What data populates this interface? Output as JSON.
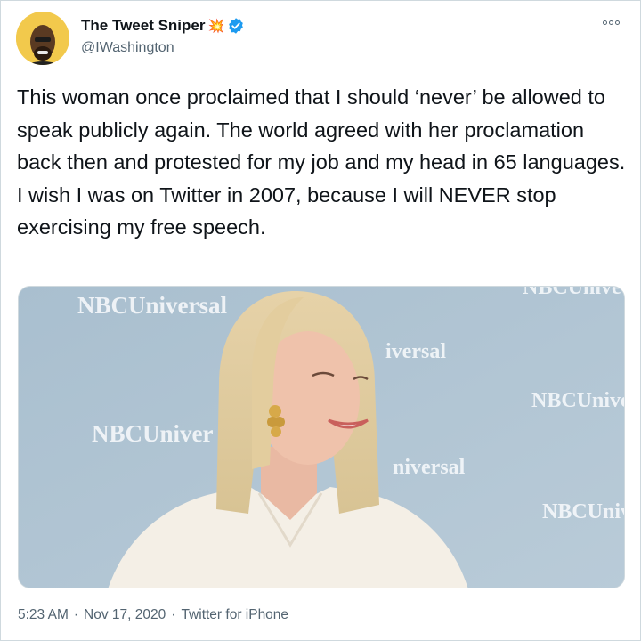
{
  "tweet": {
    "display_name": "The Tweet Sniper",
    "name_emoji": "💥",
    "handle": "@IWashington",
    "text": "This woman once proclaimed that I should ‘never’ be allowed to speak publicly again. The world agreed with her proclamation back then and protested for my job and my head in 65 languages. I wish I was on Twitter in 2007, because I will NEVER stop exercising my free speech.",
    "time": "5:23 AM",
    "date": "Nov 17, 2020",
    "source": "Twitter for iPhone",
    "separator": "·"
  },
  "media": {
    "watermarks": [
      "NBCUniversal",
      "NBCUniver",
      "NBCUnive",
      "NBCUniv",
      "iversal",
      "niversal",
      "NBCUnive",
      "NBCUnive"
    ]
  },
  "colors": {
    "verified": "#1d9bf0",
    "secondary_text": "#536471",
    "border": "#cfd9de",
    "backdrop": "#b5c8d6"
  },
  "icons": {
    "verified": "verified-badge-icon",
    "more": "more-options-icon"
  }
}
